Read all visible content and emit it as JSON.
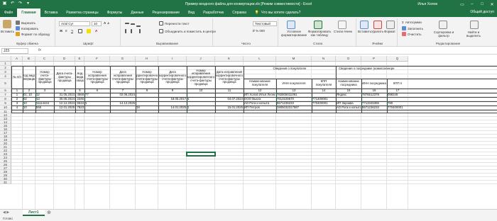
{
  "window": {
    "title": "Пример входного файла для конвертации.xls [Режим совместимости] - Excel",
    "user": "Илья Холов",
    "share": "Общий доступ"
  },
  "qat": {
    "save_icon": "save-icon",
    "undo_icon": "undo-icon",
    "redo_icon": "redo-icon",
    "customize_icon": "chevron-down-icon"
  },
  "tabs": [
    "Файл",
    "Главная",
    "Вставка",
    "Разметка страницы",
    "Формулы",
    "Данные",
    "Рецензирование",
    "Вид",
    "Разработчик",
    "Справка"
  ],
  "active_tab": "Главная",
  "tell_me": "Что вы хотите сделать?",
  "ribbon": {
    "clipboard": {
      "paste": "Вставить",
      "cut": "Вырезать",
      "copy": "Копировать",
      "painter": "Формат по образцу",
      "label": "Буфер обмена"
    },
    "font": {
      "name": "Arial Cyr",
      "size": "10",
      "label": "Шрифт"
    },
    "alignment": {
      "wrap": "Перенести текст",
      "merge": "Объединить и поместить в центре",
      "label": "Выравнивание"
    },
    "number": {
      "format": "Текстовый",
      "label": "Число"
    },
    "styles": {
      "conditional": "Условное форматирование",
      "table": "Форматировать как таблицу",
      "cell": "Стили ячеек",
      "label": "Стили"
    },
    "cells": {
      "insert": "Вставить",
      "delete": "Удалить",
      "format": "Формат",
      "label": "Ячейки"
    },
    "editing": {
      "autosum": "Автосумма",
      "fill": "Заполнить",
      "clear": "Очистить",
      "sort": "Сортировка и фильтр",
      "find": "Найти и выделить",
      "label": "Редактирование"
    }
  },
  "formula_bar": {
    "name_box": "J23",
    "fx": "fx",
    "content": ""
  },
  "columns": [
    "A",
    "B",
    "C",
    "D",
    "E",
    "F",
    "G",
    "H",
    "I",
    "J",
    "K",
    "L",
    "M",
    "N",
    "O",
    "P",
    "Q"
  ],
  "rows": [
    "1",
    "2",
    "3",
    "4",
    "5",
    "6",
    "7",
    "8",
    "9",
    "10",
    "11",
    "12",
    "13",
    "14",
    "15",
    "16",
    "17",
    "18",
    "19",
    "20",
    "21",
    "22",
    "23",
    "24",
    "25",
    "26",
    "27",
    "28",
    "29",
    "30",
    "31"
  ],
  "headers": {
    "n": "№ п/п",
    "code_op": "Код вида операции",
    "invoice_num": "Номер счета-фактуры продавца",
    "invoice_date": "Дата счета-фактуры продавца",
    "goods_code": "Код вида товара",
    "fix_num": "Номер исправления счета-фактуры продавца",
    "fix_date": "Дата исправления счета-фактуры продавца",
    "corr_num": "Номер корректировочного счета-фактуры продавца",
    "corr_date": "Дата корректировочного счета-фактуры продавца",
    "corr_fix_num": "Номер исправления корректировочного счета-фактуры продавца",
    "corr_fix_date": "Дата исправления корректировочного счета-фактуры продавца",
    "buyer": "Сведения о покупателе",
    "buyer_name": "Наименование покупателя",
    "buyer_inn": "ИНН покупателя",
    "buyer_kpp": "КПП покупателя",
    "agent": "Сведения о посреднике (комиссионере",
    "agent_name": "Наименование посредника",
    "agent_inn": "ИНН посредника",
    "agent_kpp": "КПП п"
  },
  "numbers_row": [
    "1",
    "2",
    "3",
    "4",
    "5",
    "6",
    "7",
    "8",
    "9",
    "10",
    "11",
    "12",
    "13",
    "14",
    "15",
    "16",
    "17"
  ],
  "data_rows": [
    {
      "n": "1",
      "op": "01; 10",
      "inv": "12",
      "date": "31.05.2024",
      "code": "4568",
      "fix": "77",
      "fixdate": "02.06.2024",
      "corr": "",
      "corrdate": "",
      "cfix": "",
      "cfixdate": "",
      "buyer": "ИП Холов Илья Леонидович",
      "inn": "782805011091",
      "kpp": "",
      "agent": "Яндекс",
      "ainn": "7876512378",
      "akpp": "098349"
    },
    {
      "n": "2",
      "op": "02",
      "inv": "13",
      "date": "30.06.2024",
      "code": "2345",
      "fix": "",
      "fixdate": "",
      "corr": "",
      "corrdate": "18.05.2017",
      "cfix": "1",
      "cfixdate": "04.07.2024",
      "buyer": "ООО Вьюга",
      "inn": "7813225670",
      "kpp": "771400001",
      "agent": "",
      "ainn": "",
      "akpp": ""
    },
    {
      "n": "3",
      "op": "10",
      "inv": "11114444",
      "date": "12.12.2024",
      "code": "5534",
      "fix": "1",
      "fixdate": "14.12.2025",
      "corr": "",
      "corrdate": "",
      "cfix": "",
      "cfixdate": "",
      "buyer": "АО Рога и копыта",
      "inn": "5571236233",
      "kpp": "770400001",
      "agent": "ИП Зарзава",
      "ainn": "7713345355",
      "akpp": "780"
    },
    {
      "n": "4",
      "op": "10",
      "inv": "555",
      "date": "12.01.2025",
      "code": "7823",
      "fix": "",
      "fixdate": "",
      "corr": "18",
      "corrdate": "14.01.2025",
      "cfix": "1",
      "cfixdate": "15.01.2025",
      "buyer": "ИП Петров",
      "inn": "1905032317587",
      "kpp": "",
      "agent": "АО Рога и копыта",
      "ainn": "5571236233",
      "akpp": "770400001"
    }
  ],
  "sheet_tab": "Лист1",
  "status": "Готово"
}
